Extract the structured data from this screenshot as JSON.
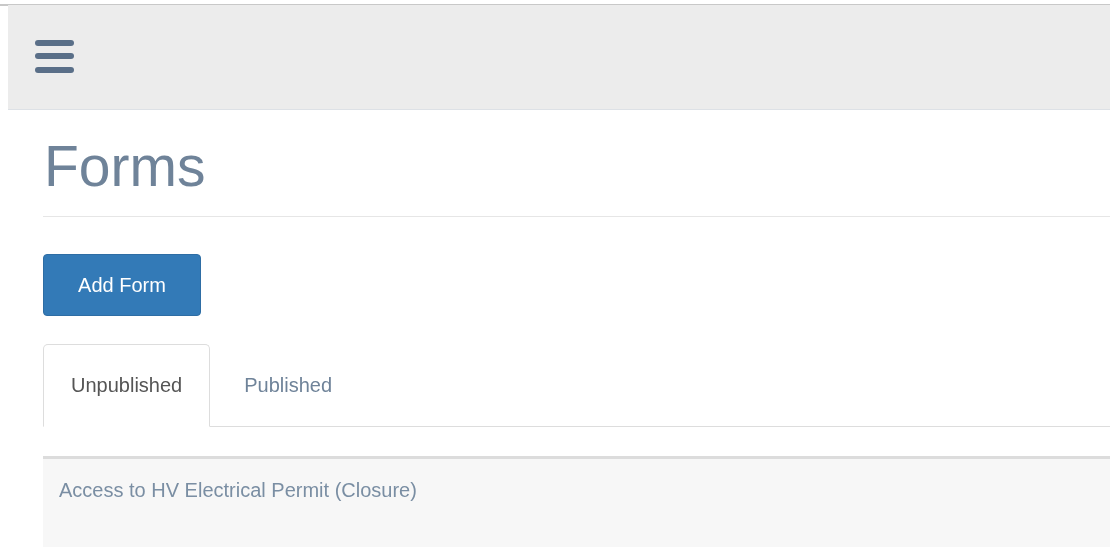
{
  "page": {
    "title": "Forms"
  },
  "add_button": {
    "label": "Add Form"
  },
  "tabs": [
    {
      "label": "Unpublished",
      "selected": true
    },
    {
      "label": "Published",
      "selected": false
    }
  ],
  "forms": [
    {
      "name": "Access to HV Electrical Permit (Closure)"
    }
  ]
}
